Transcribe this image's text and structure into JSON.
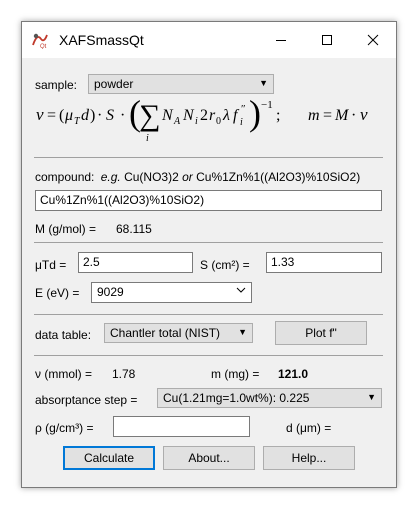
{
  "window": {
    "title": "XAFSmassQt",
    "icon": "xafs-app-icon"
  },
  "sample": {
    "label": "sample:",
    "value": "powder"
  },
  "compound": {
    "label": "compound:",
    "example_prefix": "e.g.",
    "example_1": "Cu(NO3)2",
    "or_word": "or",
    "example_2": "Cu%1Zn%1((Al2O3)%10SiO2)",
    "value": "Cu%1Zn%1((Al2O3)%10SiO2)"
  },
  "molar_mass": {
    "label": "M (g/mol) =",
    "value": "68.115"
  },
  "mu_d": {
    "label": "μTd =",
    "value": "2.5"
  },
  "area": {
    "label": "S (cm²) =",
    "value": "1.33"
  },
  "energy": {
    "label": "E (eV) =",
    "value": "9029"
  },
  "data_table": {
    "label": "data table:",
    "value": "Chantler total (NIST)"
  },
  "plot_button": "Plot f\"",
  "nu": {
    "label": "ν (mmol) =",
    "value": "1.78"
  },
  "mass": {
    "label": "m (mg) =",
    "value": "121.0"
  },
  "absorptance": {
    "label": "absorptance step =",
    "value": "Cu(1.21mg=1.0wt%): 0.225"
  },
  "density": {
    "label": "ρ (g/cm³) =",
    "value": ""
  },
  "thickness": {
    "label": "d (μm) ="
  },
  "buttons": {
    "calculate": "Calculate",
    "about": "About...",
    "help": "Help..."
  },
  "colors": {
    "accent": "#0078d7",
    "window_bg": "#f0f0f0"
  }
}
